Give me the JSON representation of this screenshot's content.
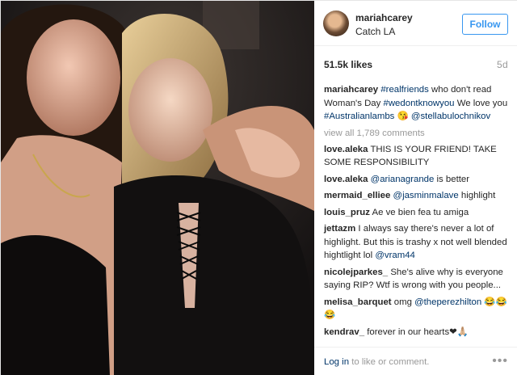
{
  "post": {
    "username": "mariahcarey",
    "location": "Catch LA",
    "follow_label": "Follow",
    "likes": "51.5k likes",
    "age": "5d"
  },
  "caption": {
    "username": "mariahcarey",
    "tag1": "#realfriends",
    "text1": " who don't read Woman's Day ",
    "tag2": "#wedontknowyou",
    "text2": " We love you ",
    "tag3": "#Australianlambs",
    "emoji": " 😘 ",
    "mention": "@stellabulochnikov"
  },
  "view_all": "view all 1,789 comments",
  "comments": [
    {
      "user": "love.aleka",
      "parts": [
        {
          "t": "THIS IS YOUR FRIEND! TAKE SOME RESPONSIBILITY",
          "link": false
        }
      ]
    },
    {
      "user": "love.aleka",
      "parts": [
        {
          "t": "@arianagrande",
          "link": true
        },
        {
          "t": " is better",
          "link": false
        }
      ]
    },
    {
      "user": "mermaid_elliee",
      "parts": [
        {
          "t": "@jasminmalave",
          "link": true
        },
        {
          "t": " highlight",
          "link": false
        }
      ]
    },
    {
      "user": "louis_pruz",
      "parts": [
        {
          "t": "Ae ve bien fea tu amiga",
          "link": false
        }
      ]
    },
    {
      "user": "jettazm",
      "parts": [
        {
          "t": "I always say there's never a lot of highlight. But this is trashy x not well blended hightlight lol ",
          "link": false
        },
        {
          "t": "@vram44",
          "link": true
        }
      ]
    },
    {
      "user": "nicolejparkes_",
      "parts": [
        {
          "t": "She's alive why is everyone saying RIP? Wtf is wrong with you people...",
          "link": false
        }
      ]
    },
    {
      "user": "melisa_barquet",
      "parts": [
        {
          "t": "omg ",
          "link": false
        },
        {
          "t": "@theperezhilton",
          "link": true
        },
        {
          "t": " 😂😂😂",
          "link": false
        }
      ]
    },
    {
      "user": "kendrav_",
      "parts": [
        {
          "t": "forever in our hearts❤🙏🏼",
          "link": false
        }
      ]
    }
  ],
  "footer": {
    "login_link": "Log in",
    "login_rest": " to like or comment.",
    "more": "•••"
  },
  "colors": {
    "link": "#003569",
    "accent": "#3897f0",
    "muted": "#999999"
  }
}
